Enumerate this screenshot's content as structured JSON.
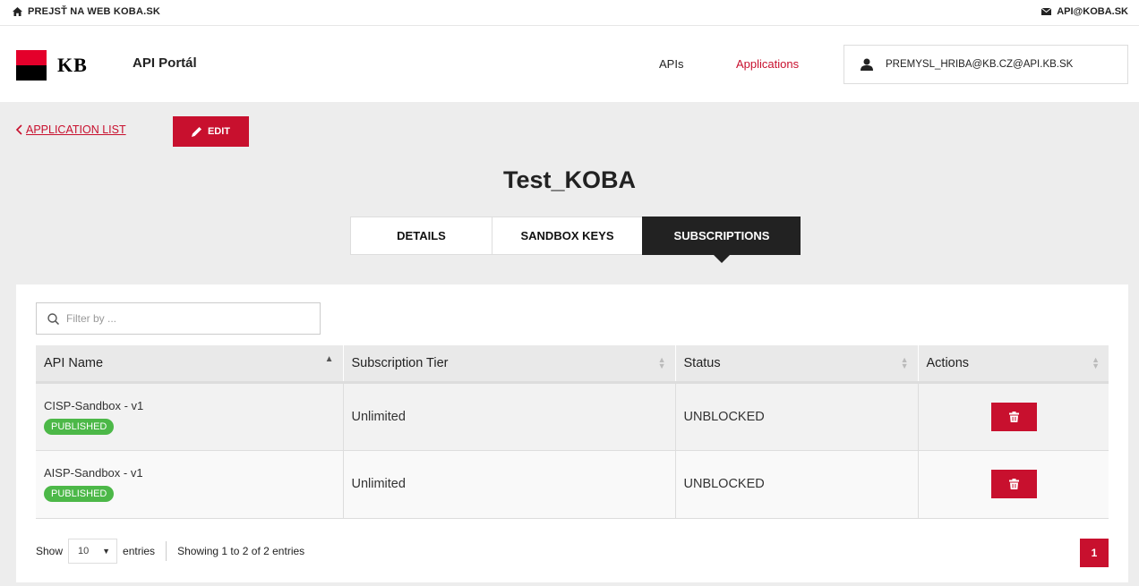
{
  "topbar": {
    "left_link": "PREJSŤ NA WEB KOBA.SK",
    "left_icon": "home-icon",
    "right_link": "API@KOBA.SK",
    "right_icon": "envelope-icon"
  },
  "header": {
    "logo_text": "KB",
    "portal_title": "API Portál",
    "nav": {
      "apis": "APIs",
      "applications": "Applications"
    },
    "user": "PREMYSL_HRIBA@KB.CZ@API.KB.SK"
  },
  "colors": {
    "brand_red": "#c8102e",
    "logo_red": "#e4002b",
    "badge_green": "#4cb848",
    "content_bg": "#ededed"
  },
  "page": {
    "back_label": "APPLICATION LIST",
    "edit_label": "EDIT",
    "title": "Test_KOBA",
    "tabs": [
      "DETAILS",
      "SANDBOX KEYS",
      "SUBSCRIPTIONS"
    ],
    "active_tab": "SUBSCRIPTIONS"
  },
  "table": {
    "filter_placeholder": "Filter by ...",
    "columns": [
      "API Name",
      "Subscription Tier",
      "Status",
      "Actions"
    ],
    "rows": [
      {
        "api_name": "CISP-Sandbox - v1",
        "badge": "PUBLISHED",
        "tier": "Unlimited",
        "status": "UNBLOCKED"
      },
      {
        "api_name": "AISP-Sandbox - v1",
        "badge": "PUBLISHED",
        "tier": "Unlimited",
        "status": "UNBLOCKED"
      }
    ],
    "footer": {
      "show": "Show",
      "page_length": "10",
      "entries": "entries",
      "info": "Showing 1 to 2 of 2 entries",
      "current_page": "1"
    }
  }
}
